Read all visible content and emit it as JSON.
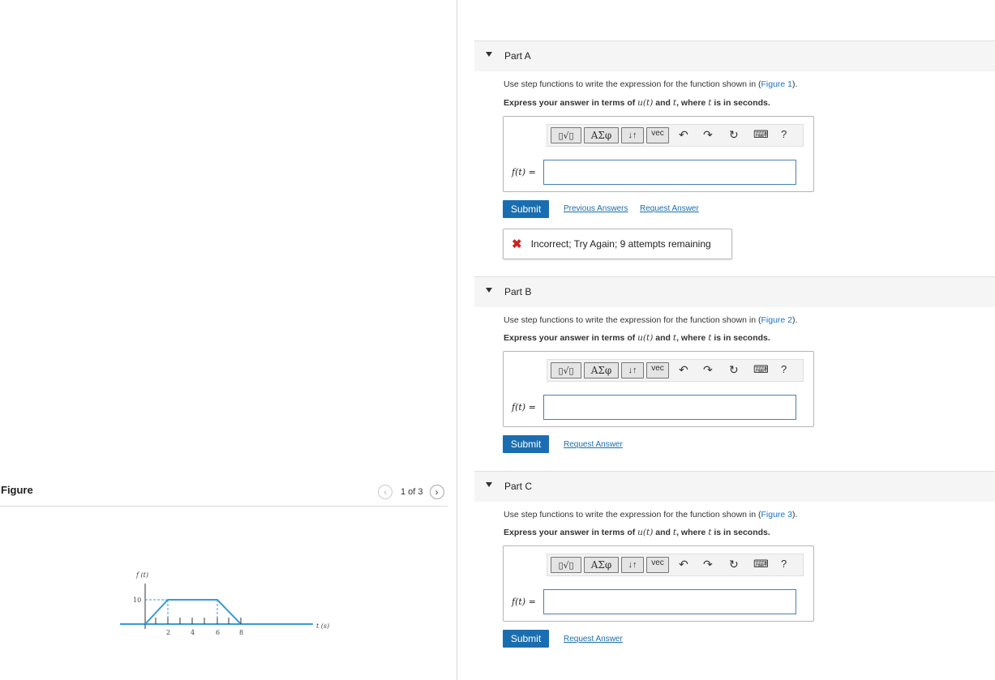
{
  "figure": {
    "title": "Figure",
    "pager": {
      "prev_icon": "‹",
      "next_icon": "›",
      "count": "1 of 3"
    },
    "graph": {
      "y_axis_label": "f (t)",
      "x_axis_label": "t (s)",
      "y_tick": "10",
      "x_ticks": [
        "2",
        "4",
        "6",
        "8"
      ]
    }
  },
  "toolbar": {
    "template_label": "▯√▯",
    "greek_label": "ΑΣφ",
    "arrows_label": "↓↑",
    "vec_label": "vec",
    "undo_icon": "↶",
    "redo_icon": "↷",
    "reset_icon": "↻",
    "keyboard_icon": "⌨",
    "help_label": "?"
  },
  "parts": [
    {
      "label": "Part A",
      "question_prefix": "Use step functions to write the expression for the function shown in (",
      "figure_link": "Figure 1",
      "question_suffix": ").",
      "instruction_prefix": "Express your answer in terms of ",
      "instruction_math1": "u(t)",
      "instruction_mid": " and ",
      "instruction_math2": "t",
      "instruction_suffix": ", where ",
      "instruction_math3": "t",
      "instruction_end": " is in seconds.",
      "answer_label": "f(t) =",
      "answer_value": "",
      "submit_label": "Submit",
      "links": [
        "Previous Answers",
        "Request Answer"
      ],
      "feedback": "Incorrect; Try Again; 9 attempts remaining"
    },
    {
      "label": "Part B",
      "question_prefix": "Use step functions to write the expression for the function shown in (",
      "figure_link": "Figure 2",
      "question_suffix": ").",
      "instruction_prefix": "Express your answer in terms of ",
      "instruction_math1": "u(t)",
      "instruction_mid": " and ",
      "instruction_math2": "t",
      "instruction_suffix": ", where ",
      "instruction_math3": "t",
      "instruction_end": " is in seconds.",
      "answer_label": "f(t) =",
      "answer_value": "",
      "submit_label": "Submit",
      "links": [
        "Request Answer"
      ]
    },
    {
      "label": "Part C",
      "question_prefix": "Use step functions to write the expression for the function shown in (",
      "figure_link": "Figure 3",
      "question_suffix": ").",
      "instruction_prefix": "Express your answer in terms of ",
      "instruction_math1": "u(t)",
      "instruction_mid": " and ",
      "instruction_math2": "t",
      "instruction_suffix": ", where ",
      "instruction_math3": "t",
      "instruction_end": " is in seconds.",
      "answer_label": "f(t) =",
      "answer_value": "",
      "submit_label": "Submit",
      "links": [
        "Request Answer"
      ]
    }
  ],
  "colors": {
    "link": "#1a6eb0",
    "submit_bg": "#1a6eb0",
    "error": "#d0221f",
    "plot_line": "#3a9ad9"
  }
}
